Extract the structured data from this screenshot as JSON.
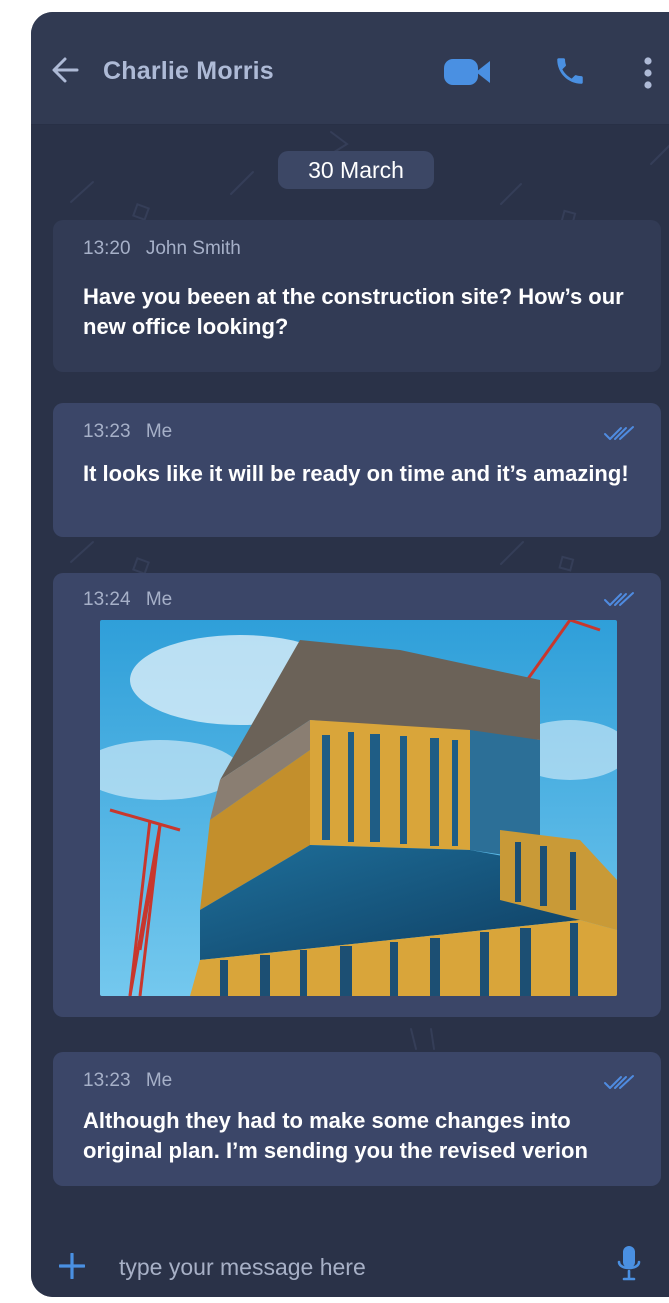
{
  "header": {
    "title": "Charlie Morris",
    "icons": [
      "back-arrow-icon",
      "video-call-icon",
      "phone-call-icon",
      "more-vertical-icon"
    ]
  },
  "date_separator": "30 March",
  "messages": [
    {
      "time": "13:20",
      "sender": "John Smith",
      "text": "Have you beeen at the construction site? How’s our new office looking?",
      "direction": "incoming"
    },
    {
      "time": "13:23",
      "sender": "Me",
      "text": "It looks like it will be ready on time and it’s amazing!",
      "direction": "outgoing",
      "status": "read"
    },
    {
      "time": "13:24",
      "sender": "Me",
      "attachment": "photo-of-building-under-construction",
      "direction": "outgoing",
      "status": "read"
    },
    {
      "time": "13:23",
      "sender": "Me",
      "text": "Although they had to make some changes into original plan. I’m sending you the revised verion",
      "direction": "outgoing",
      "status": "read"
    }
  ],
  "composer": {
    "placeholder": "type your message here",
    "icons": [
      "plus-icon",
      "microphone-icon"
    ]
  },
  "colors": {
    "background": "#2a3248",
    "header": "#313a52",
    "incoming_bubble": "#323b55",
    "outgoing_bubble": "#3b4668",
    "accent": "#4a90e2",
    "read_ticks": "#4f8be0"
  }
}
